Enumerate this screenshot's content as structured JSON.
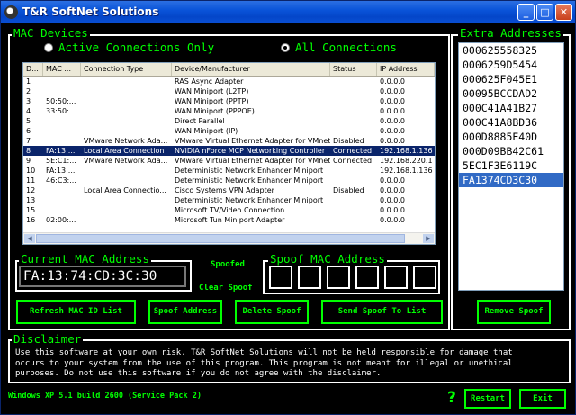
{
  "window": {
    "title": "T&R SoftNet Solutions",
    "minimize": "_",
    "maximize": "□",
    "close": "✕"
  },
  "mac_devices": {
    "title": "MAC Devices",
    "radio_active": "Active Connections Only",
    "radio_all": "All Connections",
    "selected_radio": "all",
    "columns": [
      "D...",
      "MAC ...",
      "Connection Type",
      "Device/Manufacturer",
      "Status",
      "IP Address"
    ],
    "rows": [
      [
        "1",
        "",
        "",
        "RAS Async Adapter",
        "",
        "0.0.0.0"
      ],
      [
        "2",
        "",
        "",
        "WAN Miniport (L2TP)",
        "",
        "0.0.0.0"
      ],
      [
        "3",
        "50:50:...",
        "",
        "WAN Miniport (PPTP)",
        "",
        "0.0.0.0"
      ],
      [
        "4",
        "33:50:...",
        "",
        "WAN Miniport (PPPOE)",
        "",
        "0.0.0.0"
      ],
      [
        "5",
        "",
        "",
        "Direct Parallel",
        "",
        "0.0.0.0"
      ],
      [
        "6",
        "",
        "",
        "WAN Miniport (IP)",
        "",
        "0.0.0.0"
      ],
      [
        "7",
        "",
        "VMware Network Ada...",
        "VMware Virtual Ethernet Adapter for VMnet1",
        "Disabled",
        "0.0.0.0"
      ],
      [
        "8",
        "FA:13:...",
        "Local Area Connection",
        "NVIDIA nForce MCP Networking Controller",
        "Connected",
        "192.168.1.136"
      ],
      [
        "9",
        "5E:C1:...",
        "VMware Network Ada...",
        "VMware Virtual Ethernet Adapter for VMnet8",
        "Connected",
        "192.168.220.1"
      ],
      [
        "10",
        "FA:13:...",
        "",
        "Deterministic Network Enhancer Miniport",
        "",
        "192.168.1.136"
      ],
      [
        "11",
        "46:C3:...",
        "",
        "Deterministic Network Enhancer Miniport",
        "",
        "0.0.0.0"
      ],
      [
        "12",
        "",
        "Local Area Connectio...",
        "Cisco Systems VPN Adapter",
        "Disabled",
        "0.0.0.0"
      ],
      [
        "13",
        "",
        "",
        "Deterministic Network Enhancer Miniport",
        "",
        "0.0.0.0"
      ],
      [
        "15",
        "",
        "",
        "Microsoft TV/Video Connection",
        "",
        "0.0.0.0"
      ],
      [
        "16",
        "02:00:...",
        "",
        "Microsoft Tun Miniport Adapter",
        "",
        "0.0.0.0"
      ]
    ],
    "selected_row": 7
  },
  "current_mac": {
    "title": "Current MAC Address",
    "value": "FA:13:74:CD:3C:30"
  },
  "labels": {
    "spoofed": "Spoofed",
    "clear_spoof": "Clear Spoof"
  },
  "spoof_mac": {
    "title": "Spoof MAC Address"
  },
  "buttons": {
    "refresh": "Refresh MAC ID List",
    "spoof": "Spoof Address",
    "delete": "Delete Spoof",
    "send": "Send Spoof To List",
    "remove": "Remove Spoof",
    "restart": "Restart",
    "exit": "Exit"
  },
  "extra": {
    "title": "Extra Addresses",
    "items": [
      "000625558325",
      "0006259D5454",
      "000625F045E1",
      "00095BCCDAD2",
      "000C41A41B27",
      "000C41A8BD36",
      "000D8885E40D",
      "000D09BB42C61",
      "5EC1F3E6119C",
      "FA1374CD3C30"
    ],
    "selected_index": 9
  },
  "disclaimer": {
    "title": "Disclaimer",
    "lines": [
      "Use this software at your own risk.  T&R SoftNet Solutions will not be held responsible for damage that",
      "occurs to your system from the use of this program.  This program is not meant for illegal or unethical",
      "purposes.  Do not use this software if you do not agree with the disclaimer."
    ]
  },
  "status": "Windows XP 5.1 build 2600 (Service Pack 2)",
  "help": "?",
  "colors": {
    "accent": "#00ff00",
    "selection": "#0a246a",
    "title_bar": "#0a54d9"
  }
}
